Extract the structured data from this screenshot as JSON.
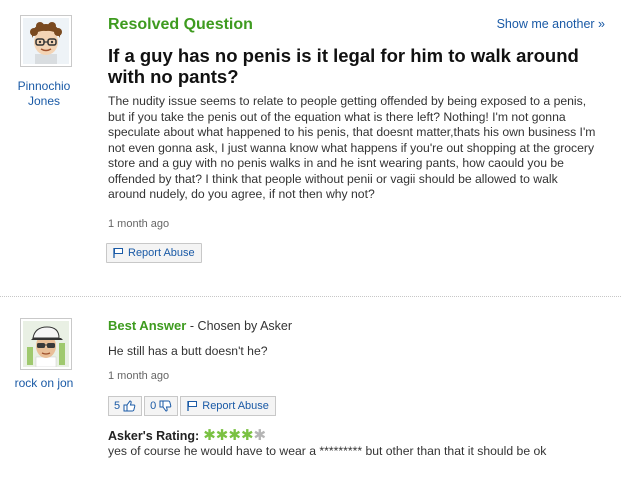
{
  "question": {
    "status_label": "Resolved Question",
    "show_another": "Show me another »",
    "title": "If a guy has no penis is it legal for him to walk around with no pants?",
    "body": "The nudity issue seems to relate to people getting offended by being exposed to a penis, but if you take the penis out of the equation what is there left? Nothing! I'm not gonna speculate about what happened to his penis, that doesnt matter,thats his own business I'm not even gonna ask, I just wanna know what happens if you're out shopping at the grocery store and a guy with no penis walks in and he isnt wearing pants, how caould you be offended by that? I think that people without penii or vagii should be allowed to walk around nudely, do you agree, if not then why not?",
    "time_ago": "1 month ago",
    "report_label": "Report Abuse",
    "asker": {
      "name_line1": "Pinnochio",
      "name_line2": "Jones",
      "avatar_icon": "cartoon-avatar-curly-hair-glasses"
    }
  },
  "answer": {
    "best_label": "Best Answer",
    "chosen_label": "- Chosen by Asker",
    "body": "He still has a butt doesn't he?",
    "time_ago": "1 month ago",
    "thumbs_up_count": "5",
    "thumbs_down_count": "0",
    "report_label": "Report Abuse",
    "answerer": {
      "name": "rock on jon",
      "avatar_icon": "cartoon-avatar-cap-sunglasses"
    }
  },
  "rating": {
    "label": "Asker's Rating:",
    "stars_filled": 4,
    "stars_total": 5,
    "star_glyph": "✱",
    "comment": "yes of course he would have to wear a ********* but other than that it should be ok"
  },
  "colors": {
    "green": "#3e9b1f",
    "link_blue": "#1a5aa6",
    "star_on": "#7ac142",
    "star_off": "#b5b5b5"
  }
}
